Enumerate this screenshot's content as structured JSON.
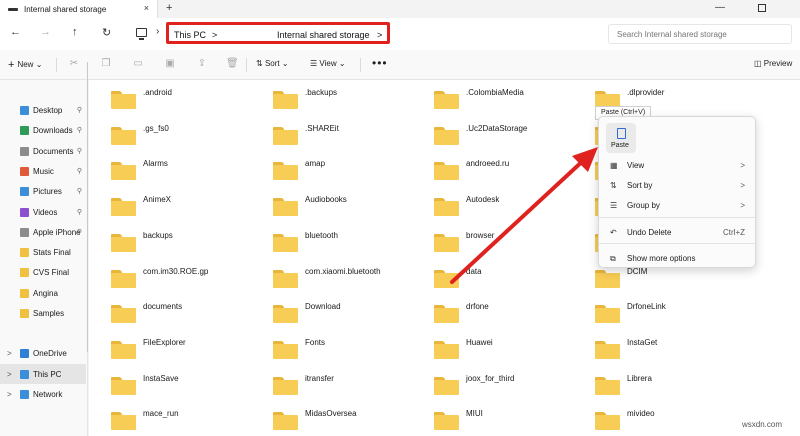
{
  "window": {
    "tab_title": "Internal shared storage",
    "tab_close": "×",
    "new_tab": "+",
    "minimize": "—"
  },
  "nav": {
    "back": "←",
    "forward": "→",
    "up": "↑",
    "refresh": "↻",
    "chevron": "›"
  },
  "breadcrumb": {
    "items": [
      "This PC",
      "Internal shared storage"
    ],
    "separator": ">",
    "highlight_color": "#e0221f"
  },
  "search": {
    "placeholder": "Search Internal shared storage"
  },
  "toolbar": {
    "new_label": "New",
    "new_icon": "+",
    "sort_label": "Sort",
    "view_label": "View",
    "more_label": "•••",
    "preview_label": "Preview",
    "dropdown": "⌄"
  },
  "sidebar": {
    "items": [
      {
        "label": "Desktop",
        "icon": "desktop-icon",
        "color": "#3b8fd9",
        "pinned": true
      },
      {
        "label": "Downloads",
        "icon": "downloads-icon",
        "color": "#2e9c57",
        "pinned": true
      },
      {
        "label": "Documents",
        "icon": "documents-icon",
        "color": "#8c8c8c",
        "pinned": true
      },
      {
        "label": "Music",
        "icon": "music-icon",
        "color": "#e05a3a",
        "pinned": true
      },
      {
        "label": "Pictures",
        "icon": "pictures-icon",
        "color": "#3b8fd9",
        "pinned": true
      },
      {
        "label": "Videos",
        "icon": "videos-icon",
        "color": "#8b4fd0",
        "pinned": true
      },
      {
        "label": "Apple iPhone",
        "icon": "phone-icon",
        "color": "#8c8c8c",
        "pinned": true
      },
      {
        "label": "Stats Final",
        "icon": "folder-icon",
        "color": "#f0c040",
        "pinned": false
      },
      {
        "label": "CVS Final",
        "icon": "folder-icon",
        "color": "#f0c040",
        "pinned": false
      },
      {
        "label": "Angina",
        "icon": "folder-icon",
        "color": "#f0c040",
        "pinned": false
      },
      {
        "label": "Samples",
        "icon": "folder-icon",
        "color": "#f0c040",
        "pinned": false
      },
      {
        "label": "OneDrive",
        "icon": "onedrive-icon",
        "color": "#2f7fd6",
        "pinned": false
      },
      {
        "label": "This PC",
        "icon": "this-pc-icon",
        "color": "#3b8fd9",
        "pinned": false,
        "selected": true
      },
      {
        "label": "Network",
        "icon": "network-icon",
        "color": "#3b8fd9",
        "pinned": false
      }
    ],
    "pin_glyph": "📌",
    "expand_glyph": ">"
  },
  "folders": [
    ".android",
    ".backups",
    ".ColombiaMedia",
    ".dlprovider",
    ".gs_fs0",
    ".SHAREit",
    ".Uc2DataStorage",
    "",
    "Alarms",
    "amap",
    "androeed.ru",
    "",
    "AnimeX",
    "Audiobooks",
    "Autodesk",
    "",
    "backups",
    "bluetooth",
    "browser",
    "",
    "com.im30.ROE.gp",
    "com.xiaomi.bluetooth",
    "data",
    "DCIM",
    "documents",
    "Download",
    "drfone",
    "DrfoneLink",
    "FileExplorer",
    "Fonts",
    "Huawei",
    "InstaGet",
    "InstaSave",
    "itransfer",
    "joox_for_third",
    "Librera",
    "mace_run",
    "MidasOversea",
    "MIUI",
    "mivideo"
  ],
  "context_menu": {
    "tooltip": "Paste (Ctrl+V)",
    "paste_label": "Paste",
    "items": [
      {
        "label": "View",
        "icon": "view-icon",
        "glyph": "▦",
        "arrow": ">"
      },
      {
        "label": "Sort by",
        "icon": "sort-icon",
        "glyph": "⇅",
        "arrow": ">"
      },
      {
        "label": "Group by",
        "icon": "group-icon",
        "glyph": "☰",
        "arrow": ">"
      },
      {
        "label": "Undo Delete",
        "icon": "undo-icon",
        "glyph": "↶",
        "shortcut": "Ctrl+Z"
      },
      {
        "label": "Show more options",
        "icon": "more-options-icon",
        "glyph": "⧉"
      }
    ]
  },
  "annotation": {
    "color": "#e0221f"
  },
  "watermark": "wsxdn.com"
}
